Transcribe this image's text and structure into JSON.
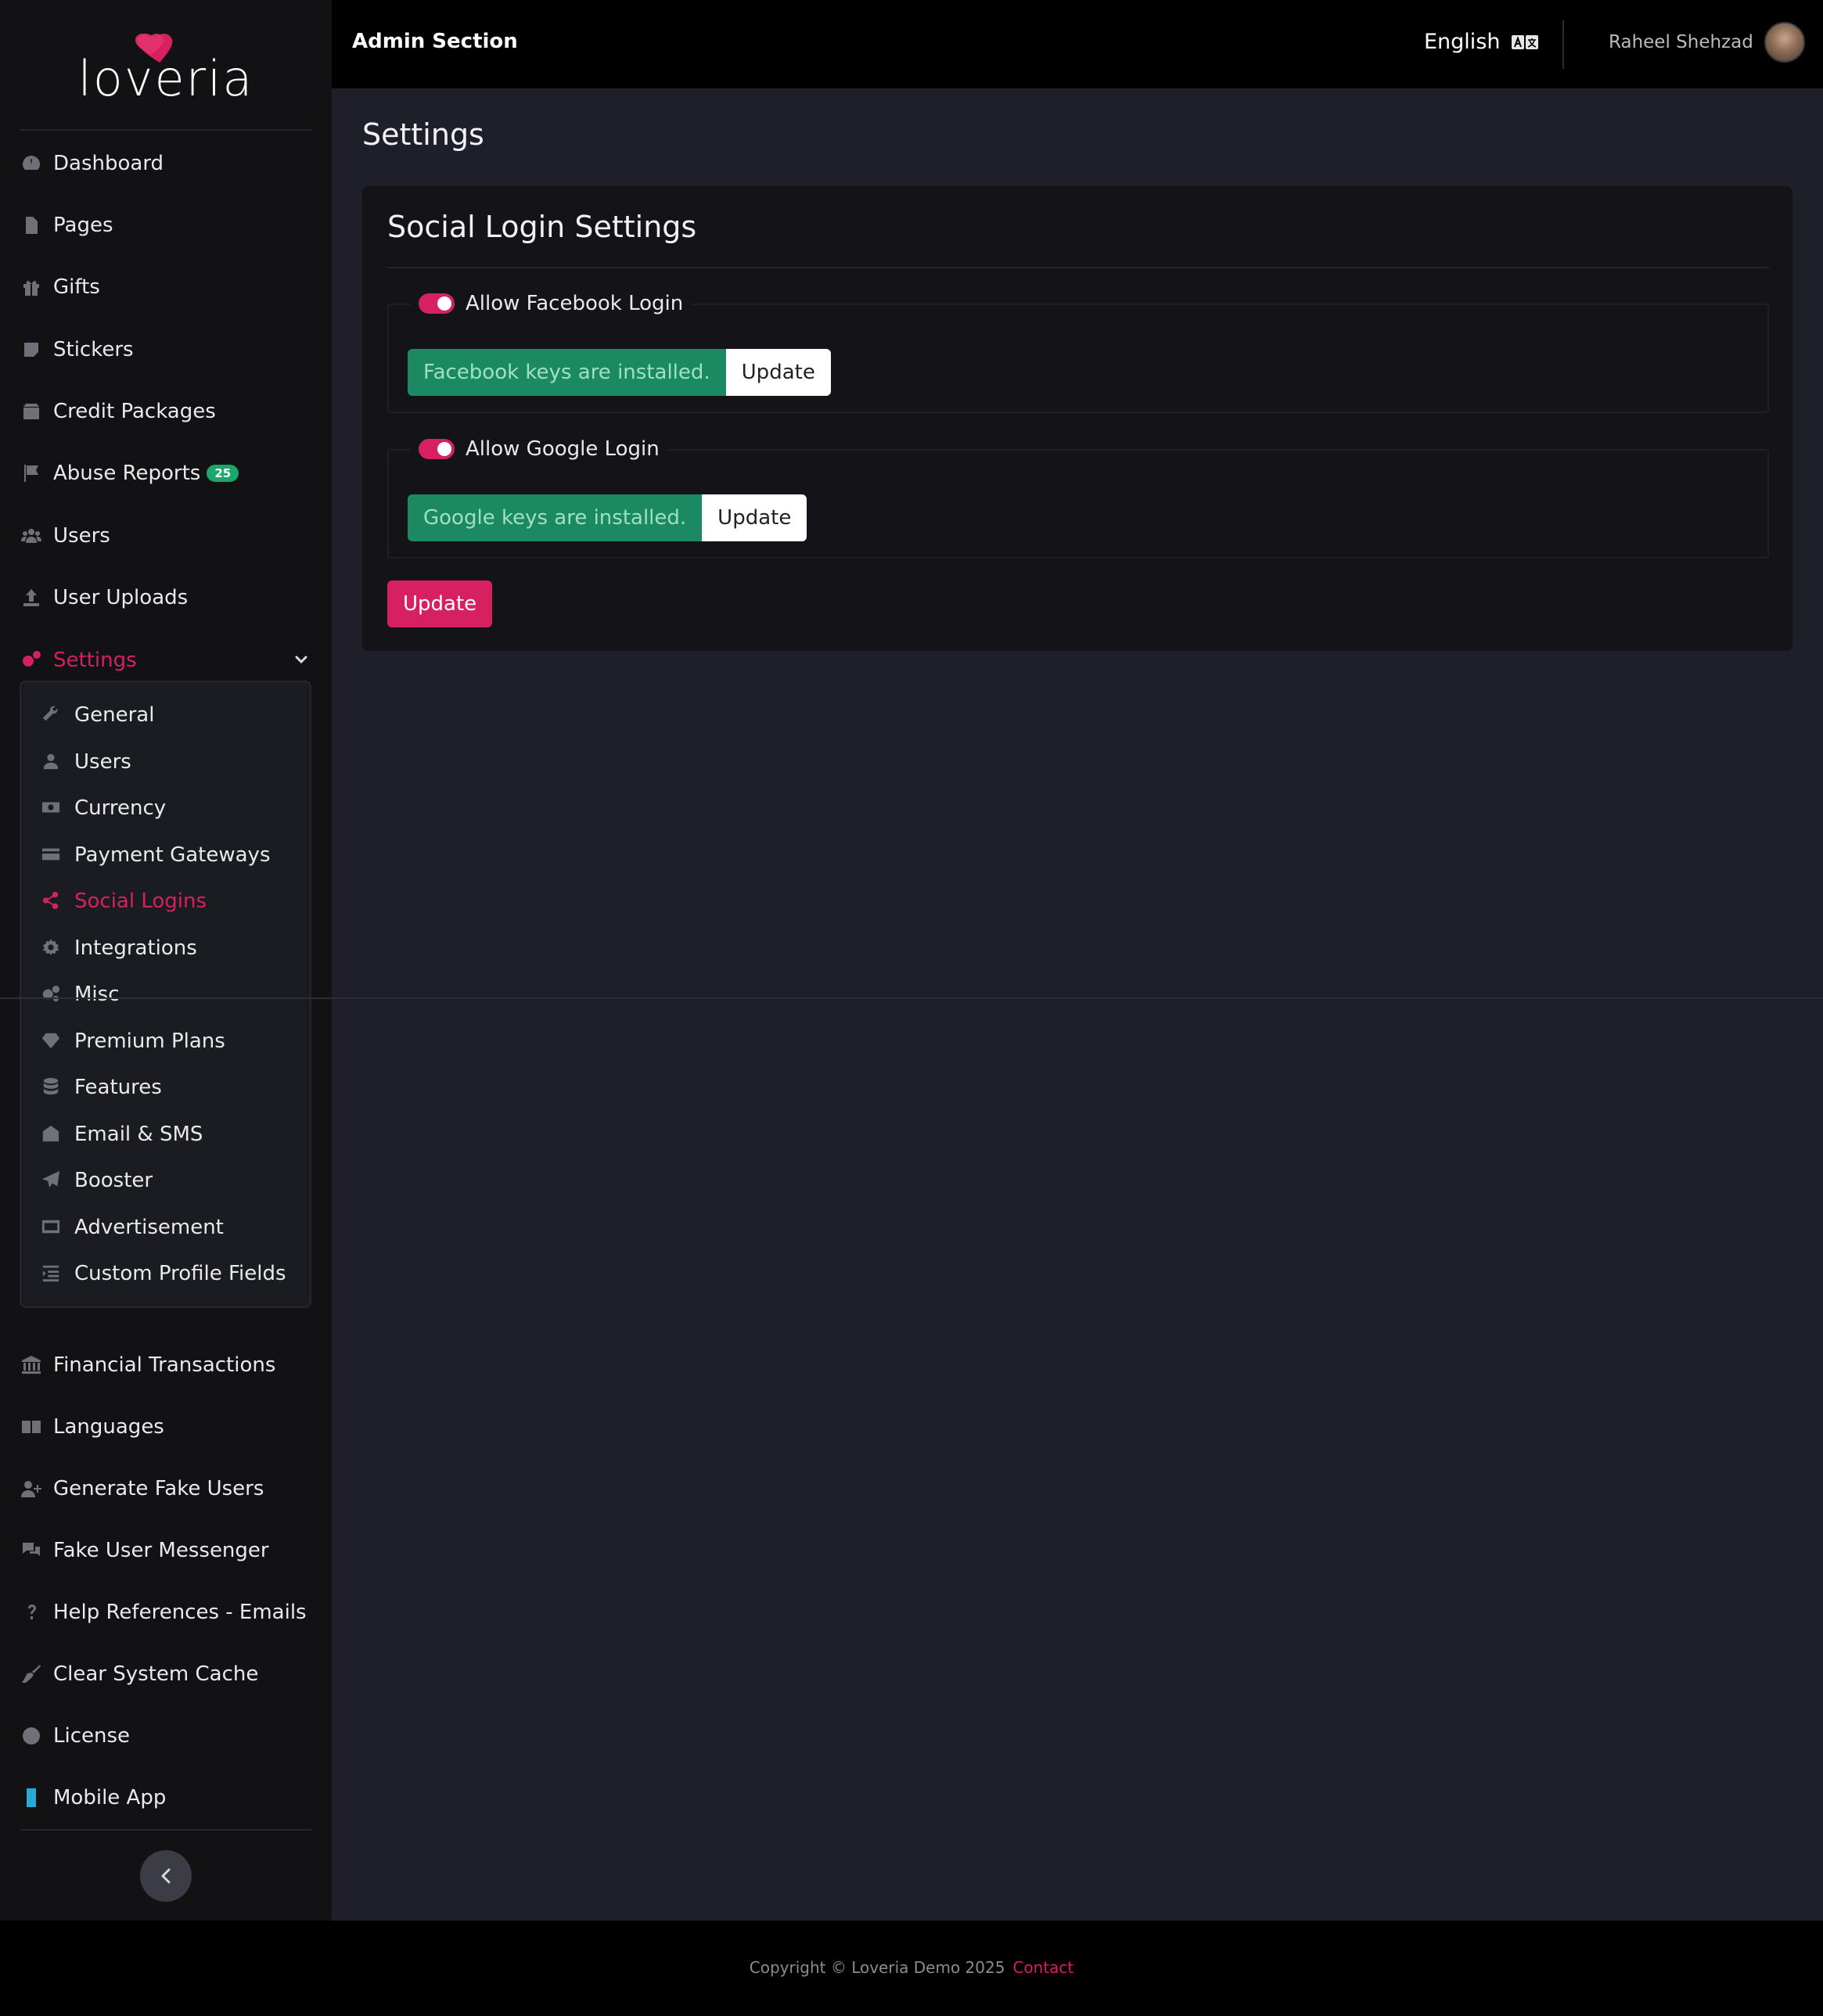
{
  "app": {
    "brand": "loveria",
    "section_title": "Admin Section",
    "language": "English",
    "user_name": "Raheel Shehzad"
  },
  "sidebar": {
    "items": [
      {
        "label": "Dashboard",
        "icon": "dashboard-icon"
      },
      {
        "label": "Pages",
        "icon": "file-icon"
      },
      {
        "label": "Gifts",
        "icon": "gift-icon"
      },
      {
        "label": "Stickers",
        "icon": "sticker-icon"
      },
      {
        "label": "Credit Packages",
        "icon": "box-icon"
      },
      {
        "label": "Abuse Reports",
        "icon": "flag-icon",
        "badge": "25"
      },
      {
        "label": "Users",
        "icon": "users-icon"
      },
      {
        "label": "User Uploads",
        "icon": "upload-icon"
      },
      {
        "label": "Settings",
        "icon": "gears-icon",
        "active": true
      }
    ],
    "settings_sub": [
      {
        "label": "General",
        "icon": "wrench-icon"
      },
      {
        "label": "Users",
        "icon": "user-icon"
      },
      {
        "label": "Currency",
        "icon": "money-icon"
      },
      {
        "label": "Payment Gateways",
        "icon": "credit-card-icon"
      },
      {
        "label": "Social Logins",
        "icon": "share-icon",
        "active": true
      },
      {
        "label": "Integrations",
        "icon": "cog-icon"
      },
      {
        "label": "Misc",
        "icon": "cogs-icon"
      },
      {
        "label": "Premium Plans",
        "icon": "gem-icon"
      },
      {
        "label": "Features",
        "icon": "database-icon"
      },
      {
        "label": "Email & SMS",
        "icon": "envelope-icon"
      },
      {
        "label": "Booster",
        "icon": "paper-plane-icon"
      },
      {
        "label": "Advertisement",
        "icon": "ad-icon"
      },
      {
        "label": "Custom Profile Fields",
        "icon": "list-icon"
      }
    ],
    "bottom_items": [
      {
        "label": "Financial Transactions",
        "icon": "bank-icon"
      },
      {
        "label": "Languages",
        "icon": "language-icon"
      },
      {
        "label": "Generate Fake Users",
        "icon": "user-plus-icon"
      },
      {
        "label": "Fake User Messenger",
        "icon": "comments-icon"
      },
      {
        "label": "Help References - Emails",
        "icon": "question-icon"
      },
      {
        "label": "Clear System Cache",
        "icon": "broom-icon"
      },
      {
        "label": "License",
        "icon": "certificate-icon"
      },
      {
        "label": "Mobile App",
        "icon": "mobile-icon"
      }
    ]
  },
  "main": {
    "page_title": "Settings",
    "card_title": "Social Login Settings",
    "facebook": {
      "toggle_label": "Allow Facebook Login",
      "enabled": true,
      "status_text": "Facebook keys are installed.",
      "update_label": "Update"
    },
    "google": {
      "toggle_label": "Allow Google Login",
      "enabled": true,
      "status_text": "Google keys are installed.",
      "update_label": "Update"
    },
    "submit_label": "Update"
  },
  "footer": {
    "copyright": "Copyright © Loveria Demo 2025",
    "contact_label": "Contact"
  },
  "colors": {
    "accent": "#d6205f",
    "success": "#1b8a63",
    "badge": "#1aa76a",
    "background": "#1e1f29",
    "sidebar": "#121215"
  }
}
